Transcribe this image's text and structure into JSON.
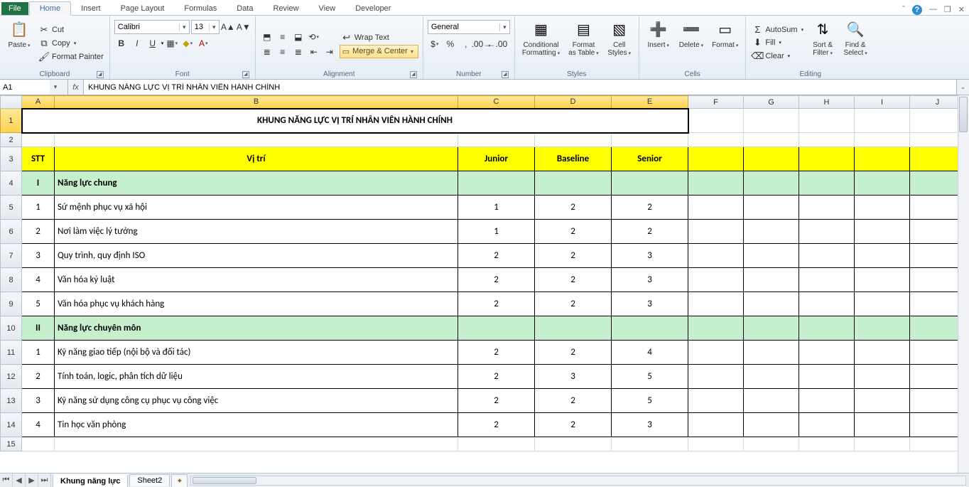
{
  "tabs": {
    "file": "File",
    "home": "Home",
    "insert": "Insert",
    "page_layout": "Page Layout",
    "formulas": "Formulas",
    "data": "Data",
    "review": "Review",
    "view": "View",
    "developer": "Developer"
  },
  "ribbon": {
    "clipboard": {
      "paste": "Paste",
      "cut": "Cut",
      "copy": "Copy",
      "format_painter": "Format Painter",
      "label": "Clipboard"
    },
    "font": {
      "name": "Calibri",
      "size": "13",
      "label": "Font"
    },
    "alignment": {
      "wrap": "Wrap Text",
      "merge": "Merge & Center",
      "label": "Alignment"
    },
    "number": {
      "format": "General",
      "label": "Number"
    },
    "styles": {
      "cond": "Conditional\nFormatting",
      "table": "Format\nas Table",
      "cell": "Cell\nStyles",
      "label": "Styles"
    },
    "cells": {
      "insert": "Insert",
      "delete": "Delete",
      "format": "Format",
      "label": "Cells"
    },
    "editing": {
      "autosum": "AutoSum",
      "fill": "Fill",
      "clear": "Clear",
      "sort": "Sort &\nFilter",
      "find": "Find &\nSelect",
      "label": "Editing"
    }
  },
  "formula_bar": {
    "cell_ref": "A1",
    "formula": "KHUNG NĂNG LỰC VỊ TRÍ NHÂN VIÊN HÀNH CHÍNH"
  },
  "columns": [
    "A",
    "B",
    "C",
    "D",
    "E",
    "F",
    "G",
    "H",
    "I",
    "J"
  ],
  "sheet": {
    "title": "KHUNG NĂNG LỰC VỊ TRÍ NHÂN VIÊN HÀNH CHÍNH",
    "headers": {
      "stt": "STT",
      "vitri": "Vị trí",
      "junior": "Junior",
      "baseline": "Baseline",
      "senior": "Senior"
    },
    "sections": [
      {
        "num": "I",
        "name": "Năng lực chung",
        "rows": [
          {
            "stt": "1",
            "name": "Sứ mệnh phục vụ xã hội",
            "j": "1",
            "b": "2",
            "s": "2"
          },
          {
            "stt": "2",
            "name": "Nơi làm việc lý tưởng",
            "j": "1",
            "b": "2",
            "s": "2"
          },
          {
            "stt": "3",
            "name": "Quy trình, quy định ISO",
            "j": "2",
            "b": "2",
            "s": "3"
          },
          {
            "stt": "4",
            "name": "Văn hóa kỷ luật",
            "j": "2",
            "b": "2",
            "s": "3"
          },
          {
            "stt": "5",
            "name": "Văn hóa phục vụ khách hàng",
            "j": "2",
            "b": "2",
            "s": "3"
          }
        ]
      },
      {
        "num": "II",
        "name": "Năng lực chuyên môn",
        "rows": [
          {
            "stt": "1",
            "name": "Kỹ năng giao tiếp (nội bộ và đối tác)",
            "j": "2",
            "b": "2",
            "s": "4"
          },
          {
            "stt": "2",
            "name": "Tính toán, logic, phân tích dữ liệu",
            "j": "2",
            "b": "3",
            "s": "5"
          },
          {
            "stt": "3",
            "name": "Kỹ năng sử dụng công cụ phục vụ công việc",
            "j": "2",
            "b": "2",
            "s": "5"
          },
          {
            "stt": "4",
            "name": "Tin học văn phòng",
            "j": "2",
            "b": "2",
            "s": "3"
          }
        ]
      }
    ]
  },
  "sheet_tabs": {
    "active": "Khung năng lực",
    "other": "Sheet2"
  }
}
